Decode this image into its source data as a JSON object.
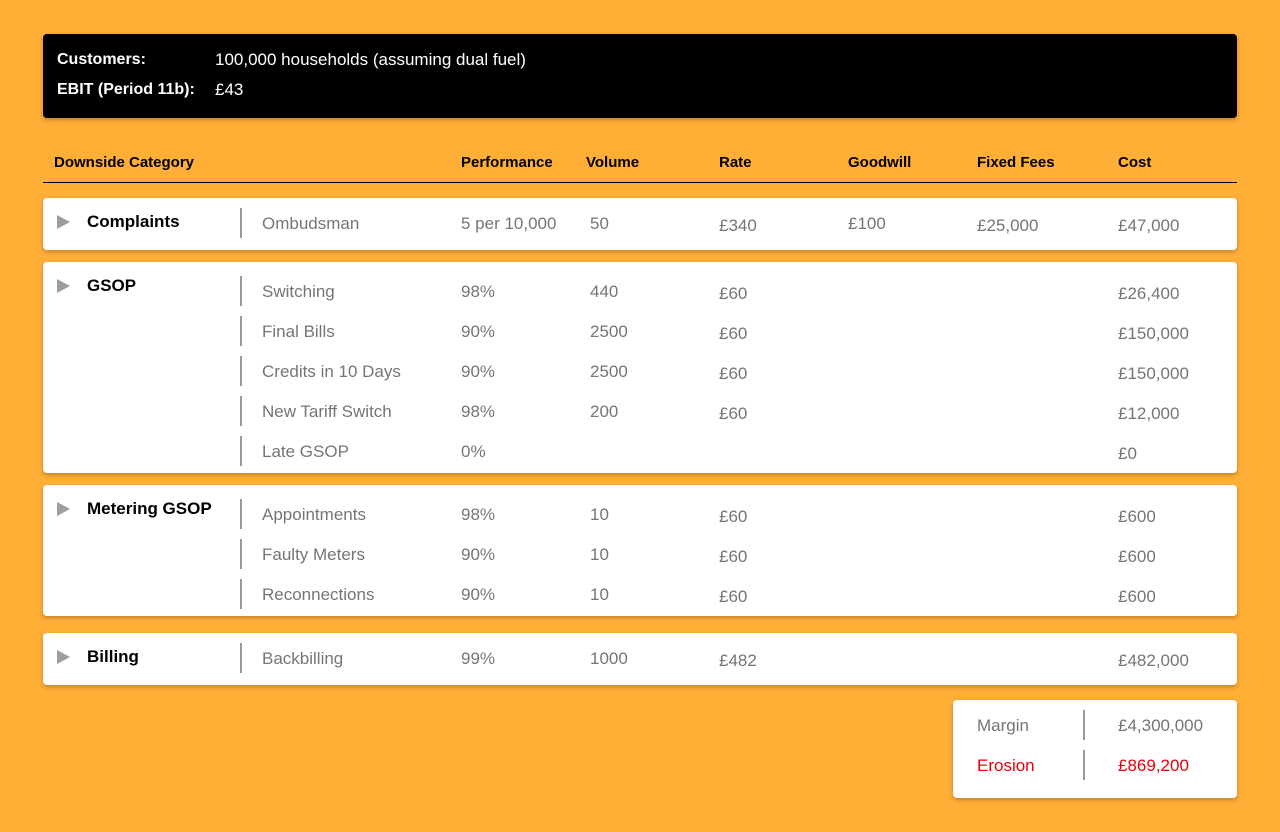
{
  "header": {
    "customers_label": "Customers:",
    "customers_value": "100,000 households (assuming dual fuel)",
    "ebit_label": "EBIT (Period 11b):",
    "ebit_value": "£43"
  },
  "columns": {
    "category": "Downside Category",
    "performance": "Performance",
    "volume": "Volume",
    "rate": "Rate",
    "goodwill": "Goodwill",
    "fixed_fees": "Fixed Fees",
    "cost": "Cost"
  },
  "groups": [
    {
      "category": "Complaints",
      "rows": [
        {
          "sub": "Ombudsman",
          "performance": "5 per 10,000",
          "volume": "50",
          "rate": "£340",
          "goodwill": "£100",
          "fixed_fees": "£25,000",
          "cost": "£47,000"
        }
      ]
    },
    {
      "category": "GSOP",
      "rows": [
        {
          "sub": "Switching",
          "performance": "98%",
          "volume": "440",
          "rate": "£60",
          "goodwill": "",
          "fixed_fees": "",
          "cost": "£26,400"
        },
        {
          "sub": "Final Bills",
          "performance": "90%",
          "volume": "2500",
          "rate": "£60",
          "goodwill": "",
          "fixed_fees": "",
          "cost": "£150,000"
        },
        {
          "sub": "Credits in 10 Days",
          "performance": "90%",
          "volume": "2500",
          "rate": "£60",
          "goodwill": "",
          "fixed_fees": "",
          "cost": "£150,000"
        },
        {
          "sub": "New Tariff Switch",
          "performance": "98%",
          "volume": "200",
          "rate": "£60",
          "goodwill": "",
          "fixed_fees": "",
          "cost": "£12,000"
        },
        {
          "sub": "Late GSOP",
          "performance": "0%",
          "volume": "",
          "rate": "",
          "goodwill": "",
          "fixed_fees": "",
          "cost": "£0"
        }
      ]
    },
    {
      "category": "Metering GSOP",
      "rows": [
        {
          "sub": "Appointments",
          "performance": "98%",
          "volume": "10",
          "rate": "£60",
          "goodwill": "",
          "fixed_fees": "",
          "cost": "£600"
        },
        {
          "sub": "Faulty Meters",
          "performance": "90%",
          "volume": "10",
          "rate": "£60",
          "goodwill": "",
          "fixed_fees": "",
          "cost": "£600"
        },
        {
          "sub": "Reconnections",
          "performance": "90%",
          "volume": "10",
          "rate": "£60",
          "goodwill": "",
          "fixed_fees": "",
          "cost": "£600"
        }
      ]
    },
    {
      "category": "Billing",
      "rows": [
        {
          "sub": "Backbilling",
          "performance": "99%",
          "volume": "1000",
          "rate": "£482",
          "goodwill": "",
          "fixed_fees": "",
          "cost": "£482,000"
        }
      ]
    }
  ],
  "summary": {
    "margin_label": "Margin",
    "margin_value": "£4,300,000",
    "erosion_label": "Erosion",
    "erosion_value": "£869,200"
  },
  "colors": {
    "background": "#FFAE36",
    "muted_text": "#757575",
    "erosion": "#E8000B",
    "margin": "#757575"
  }
}
